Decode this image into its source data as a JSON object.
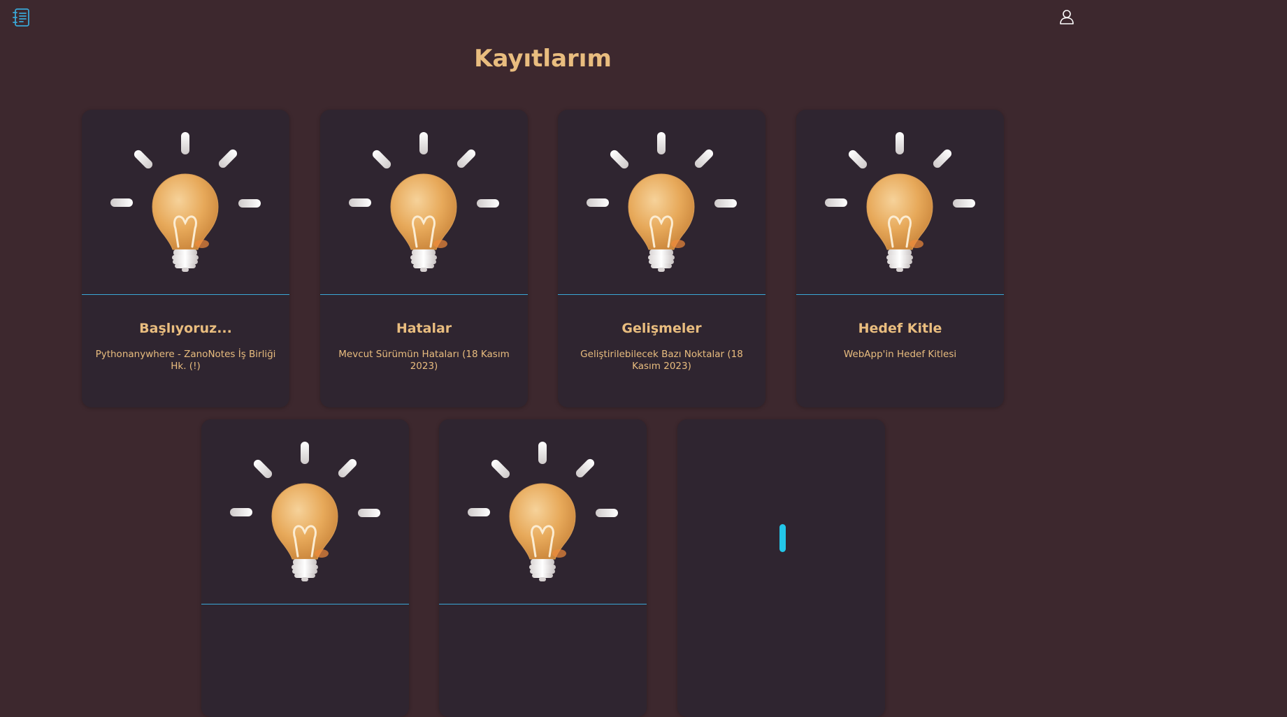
{
  "header": {
    "logo_icon": "notes-list-icon",
    "user_icon": "user-icon",
    "accent": "#3aa7d6"
  },
  "page": {
    "title": "Kayıtlarım"
  },
  "colors": {
    "background": "#3d282e",
    "card": "#2f2530",
    "text": "#e9bd7f",
    "divider": "#3aa7d6",
    "loader": "#23c6e8"
  },
  "cards": [
    {
      "title": "Başlıyoruz...",
      "subtitle": "Pythonanywhere - ZanoNotes İş Birliği Hk. (!)",
      "image_icon": "lightbulb-icon"
    },
    {
      "title": "Hatalar",
      "subtitle": "Mevcut Sürümün Hataları (18 Kasım 2023)",
      "image_icon": "lightbulb-icon"
    },
    {
      "title": "Gelişmeler",
      "subtitle": "Geliştirilebilecek Bazı Noktalar (18 Kasım 2023)",
      "image_icon": "lightbulb-icon"
    },
    {
      "title": "Hedef Kitle",
      "subtitle": "WebApp'in Hedef Kitlesi",
      "image_icon": "lightbulb-icon"
    },
    {
      "title": "",
      "subtitle": "",
      "image_icon": "lightbulb-icon"
    },
    {
      "title": "",
      "subtitle": "",
      "image_icon": "lightbulb-icon"
    },
    {
      "title": "",
      "subtitle": "",
      "image_icon": "loading-spinner-icon"
    }
  ]
}
